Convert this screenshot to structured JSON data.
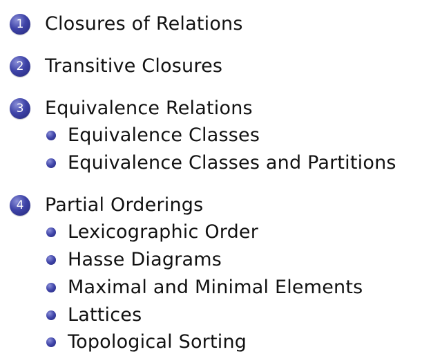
{
  "toc": {
    "sections": [
      {
        "number": "1",
        "title": "Closures of Relations",
        "subsections": []
      },
      {
        "number": "2",
        "title": "Transitive Closures",
        "subsections": []
      },
      {
        "number": "3",
        "title": "Equivalence Relations",
        "subsections": [
          "Equivalence Classes",
          "Equivalence Classes and Partitions"
        ]
      },
      {
        "number": "4",
        "title": "Partial Orderings",
        "subsections": [
          "Lexicographic Order",
          "Hasse Diagrams",
          "Maximal and Minimal Elements",
          "Lattices",
          "Topological Sorting"
        ]
      }
    ]
  },
  "colors": {
    "bullet": "#3f44a8",
    "text": "#111111",
    "background": "#ffffff"
  }
}
